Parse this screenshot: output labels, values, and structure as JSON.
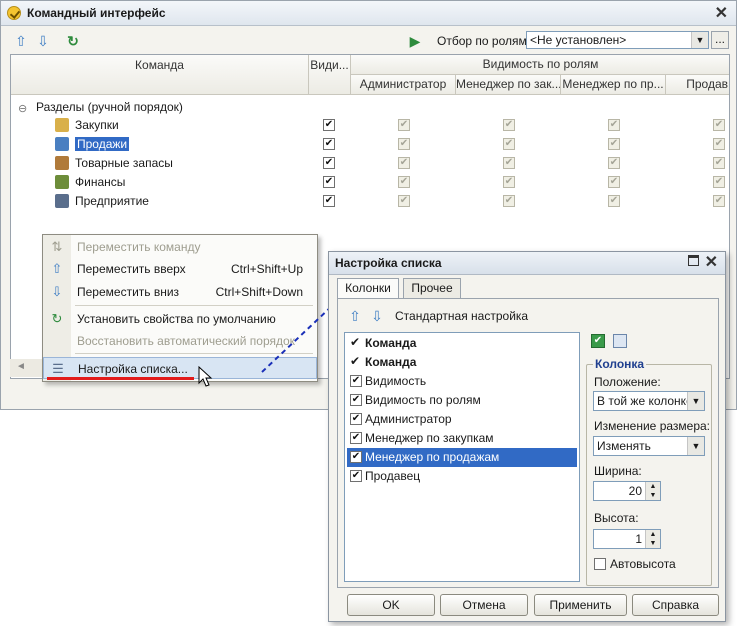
{
  "main_window": {
    "title": "Командный интерфейс",
    "role_filter_label": "Отбор по ролям:",
    "role_filter_value": "<Не установлен>",
    "more_button": "..."
  },
  "grid": {
    "header_command": "Команда",
    "header_visibility": "Види...",
    "header_visibility_by_roles": "Видимость по ролям",
    "role_columns": [
      "Администратор",
      "Менеджер по зак...",
      "Менеджер по пр...",
      "Продав"
    ],
    "tree_root": "Разделы (ручной порядок)",
    "rows": [
      {
        "label": "Закупки",
        "icon": "purchases-icon",
        "visible": true,
        "selected": false
      },
      {
        "label": "Продажи",
        "icon": "sales-icon",
        "visible": true,
        "selected": true
      },
      {
        "label": "Товарные запасы",
        "icon": "inventory-icon",
        "visible": true,
        "selected": false
      },
      {
        "label": "Финансы",
        "icon": "finance-icon",
        "visible": true,
        "selected": false
      },
      {
        "label": "Предприятие",
        "icon": "enterprise-icon",
        "visible": true,
        "selected": false
      }
    ]
  },
  "context_menu": {
    "items": [
      {
        "label": "Переместить команду",
        "shortcut": "",
        "icon": "move-command-icon",
        "disabled": true
      },
      {
        "label": "Переместить вверх",
        "shortcut": "Ctrl+Shift+Up",
        "icon": "arrow-up-icon",
        "disabled": false
      },
      {
        "label": "Переместить вниз",
        "shortcut": "Ctrl+Shift+Down",
        "icon": "arrow-down-icon",
        "disabled": false
      },
      {
        "label": "Установить свойства по умолчанию",
        "shortcut": "",
        "icon": "default-properties-icon",
        "disabled": false
      },
      {
        "label": "Восстановить автоматический порядок",
        "shortcut": "",
        "icon": "",
        "disabled": true
      },
      {
        "label": "Настройка списка...",
        "shortcut": "",
        "icon": "list-settings-icon",
        "disabled": false,
        "highlighted": true
      }
    ]
  },
  "dialog": {
    "title": "Настройка списка",
    "tabs": [
      "Колонки",
      "Прочее"
    ],
    "standard_settings": "Стандартная настройка",
    "columns": [
      {
        "label": "Команда",
        "kind": "mark",
        "checked": true,
        "bold": true
      },
      {
        "label": "Команда",
        "kind": "mark",
        "checked": true,
        "bold": true
      },
      {
        "label": "Видимость",
        "kind": "checkbox",
        "checked": true
      },
      {
        "label": "Видимость по ролям",
        "kind": "checkbox",
        "checked": true
      },
      {
        "label": "Администратор",
        "kind": "checkbox",
        "checked": true
      },
      {
        "label": "Менеджер по закупкам",
        "kind": "checkbox",
        "checked": true
      },
      {
        "label": "Менеджер по продажам",
        "kind": "checkbox",
        "checked": true,
        "selected": true
      },
      {
        "label": "Продавец",
        "kind": "checkbox",
        "checked": true
      }
    ],
    "column_group": "Колонка",
    "position_label": "Положение:",
    "position_value": "В той же колонке",
    "resize_label": "Изменение размера:",
    "resize_value": "Изменять",
    "width_label": "Ширина:",
    "width_value": "20",
    "height_label": "Высота:",
    "height_value": "1",
    "autoheight_label": "Автовысота",
    "buttons": {
      "ok": "OK",
      "cancel": "Отмена",
      "apply": "Применить",
      "help": "Справка"
    }
  },
  "colors": {
    "selection": "#316ac5",
    "accent_red": "#e21b1b",
    "arrow_blue": "#1a2fb8"
  }
}
